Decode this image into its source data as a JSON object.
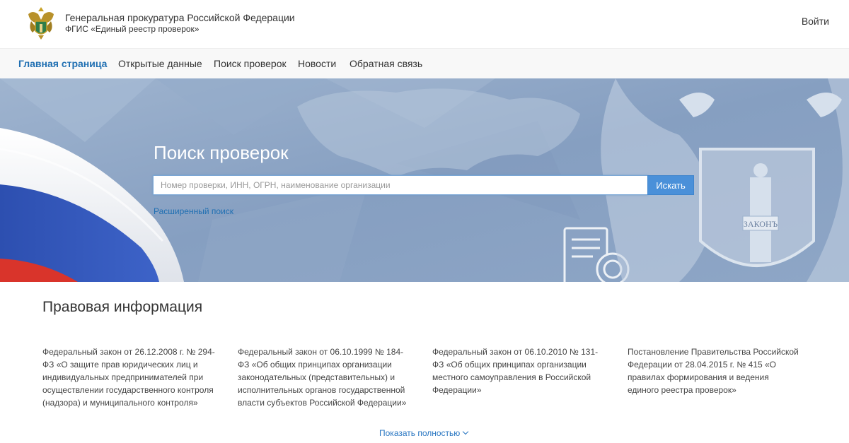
{
  "header": {
    "org_name": "Генеральная прокуратура Российской Федерации",
    "org_subtitle": "ФГИС «Единый реестр проверок»",
    "login_label": "Войти",
    "logo_icon": "double-headed-eagle-emblem"
  },
  "nav": {
    "items": [
      {
        "label": "Главная страница",
        "active": true
      },
      {
        "label": "Открытые данные",
        "active": false
      },
      {
        "label": "Поиск проверок",
        "active": false
      },
      {
        "label": "Новости",
        "active": false
      },
      {
        "label": "Обратная связь",
        "active": false
      }
    ]
  },
  "hero": {
    "title": "Поиск проверок",
    "search_placeholder": "Номер проверки, ИНН, ОГРН, наименование организации",
    "search_value": "",
    "search_button": "Искать",
    "advanced_search": "Расширенный поиск",
    "emblem_text": "ЗАКОНЪ"
  },
  "legal": {
    "title": "Правовая информация",
    "items": [
      "Федеральный закон от 26.12.2008 г. № 294-ФЗ «О защите прав юридических лиц и индивидуальных предпринимателей при осуществлении государственного контроля (надзора) и муниципального контроля»",
      "Федеральный закон от 06.10.1999 № 184-ФЗ «Об общих принципах организации законодательных (представительных) и исполнительных органов государственной власти субъектов Российской Федерации»",
      "Федеральный закон от 06.10.2010 № 131-ФЗ «Об общих принципах организации местного самоуправления в Российской Федерации»",
      "Постановление Правительства Российской Федерации от 28.04.2015 г. № 415 «О правилах формирования и ведения единого реестра проверок»"
    ],
    "show_more": "Показать полностью"
  },
  "colors": {
    "accent": "#1f6fb2",
    "button": "#4a90d9",
    "hero_bg": "#8aa3c4"
  }
}
